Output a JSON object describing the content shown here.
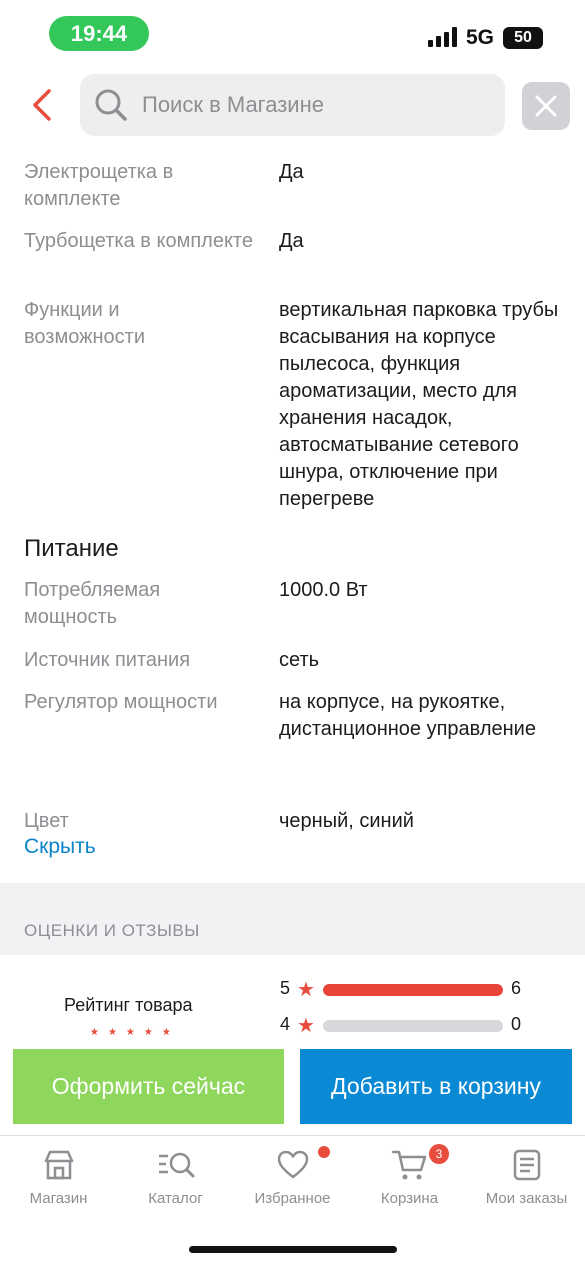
{
  "status_bar": {
    "time": "19:44",
    "network": "5G",
    "battery": "50"
  },
  "header": {
    "search_placeholder": "Поиск в Магазине",
    "back_icon": "chevron-left-icon",
    "close_icon": "close-icon",
    "accent": "#e74c3c"
  },
  "specs": [
    {
      "key": "Электрощетка в комплекте",
      "value": "Да"
    },
    {
      "key": "Турбощетка в комплекте",
      "value": "Да"
    },
    {
      "key": "Функции и возможности",
      "value": "вертикальная парковка трубы всасывания на корпусе пылесоса, функция ароматизации, место для хранения насадок, автосматывание сетевого шнура, отключение при перегреве"
    }
  ],
  "power_section": {
    "title": "Питание",
    "rows": [
      {
        "key": "Потребляемая мощность",
        "value": "1000.0 Вт"
      },
      {
        "key": "Источник питания",
        "value": "сеть"
      },
      {
        "key": "Регулятор мощности",
        "value": "на корпусе, на рукоятке, дистанционное управление"
      },
      {
        "key": "Цвет",
        "value": "черный, синий"
      }
    ]
  },
  "hide_link": "Скрыть",
  "reviews": {
    "title": "ОЦЕНКИ И ОТЗЫВЫ",
    "rating_label": "Рейтинг товара",
    "bars": [
      {
        "stars": "5",
        "count": "6",
        "fraction": 1.0
      },
      {
        "stars": "4",
        "count": "0",
        "fraction": 0.0
      }
    ]
  },
  "actions": {
    "buy_now": "Оформить сейчас",
    "add_to_cart": "Добавить в корзину",
    "buy_now_color": "#8fd65c",
    "add_to_cart_color": "#0a8ad4"
  },
  "tabbar": {
    "items": [
      {
        "label": "Магазин",
        "icon": "store-icon"
      },
      {
        "label": "Каталог",
        "icon": "catalog-search-icon"
      },
      {
        "label": "Избранное",
        "icon": "heart-icon"
      },
      {
        "label": "Корзина",
        "icon": "cart-icon",
        "badge": "3"
      },
      {
        "label": "Мои заказы",
        "icon": "orders-icon"
      }
    ]
  }
}
